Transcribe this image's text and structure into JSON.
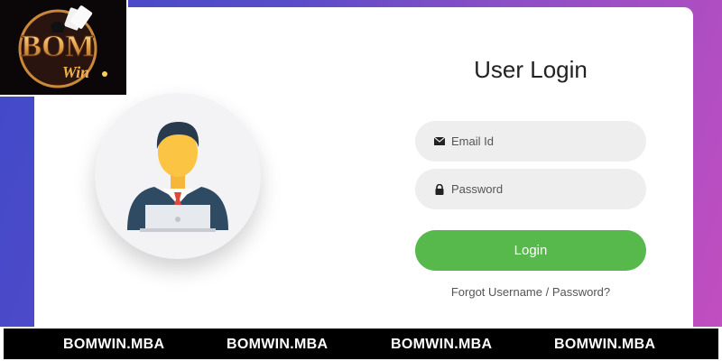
{
  "logo": {
    "brand_text": "BOM",
    "brand_sub": "Win"
  },
  "login": {
    "title": "User Login",
    "email_placeholder": "Email Id",
    "password_placeholder": "Password",
    "login_label": "Login",
    "forgot_label": "Forgot Username / Password?"
  },
  "icons": {
    "email": "envelope-icon",
    "password": "lock-icon",
    "avatar": "user-avatar-icon"
  },
  "banner": {
    "items": [
      "BOMWIN.MBA",
      "BOMWIN.MBA",
      "BOMWIN.MBA",
      "BOMWIN.MBA"
    ]
  },
  "colors": {
    "gradient_start": "#3f49c9",
    "gradient_end": "#c24ec0",
    "login_button": "#57b94c",
    "input_bg": "#eeeeee",
    "banner_bg": "#000000"
  }
}
